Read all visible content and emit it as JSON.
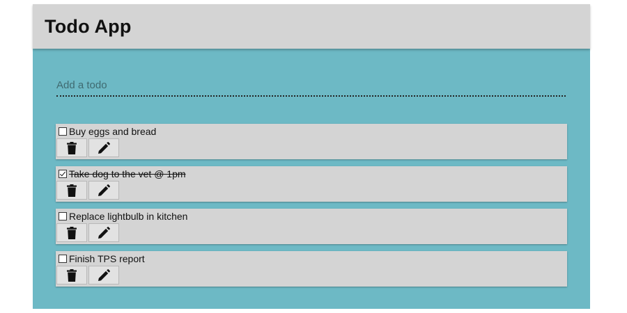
{
  "header": {
    "title": "Todo App"
  },
  "add_todo": {
    "placeholder": "Add a todo",
    "value": ""
  },
  "todos": [
    {
      "text": "Buy eggs and bread",
      "done": false
    },
    {
      "text": "Take dog to the vet @ 1pm",
      "done": true
    },
    {
      "text": "Replace lightbulb in kitchen",
      "done": false
    },
    {
      "text": "Finish TPS report",
      "done": false
    }
  ],
  "icons": {
    "delete": "trash-icon",
    "edit": "pencil-icon"
  },
  "colors": {
    "header_bg": "#d4d4d4",
    "app_bg": "#6db9c5",
    "item_bg": "#d4d4d4"
  }
}
